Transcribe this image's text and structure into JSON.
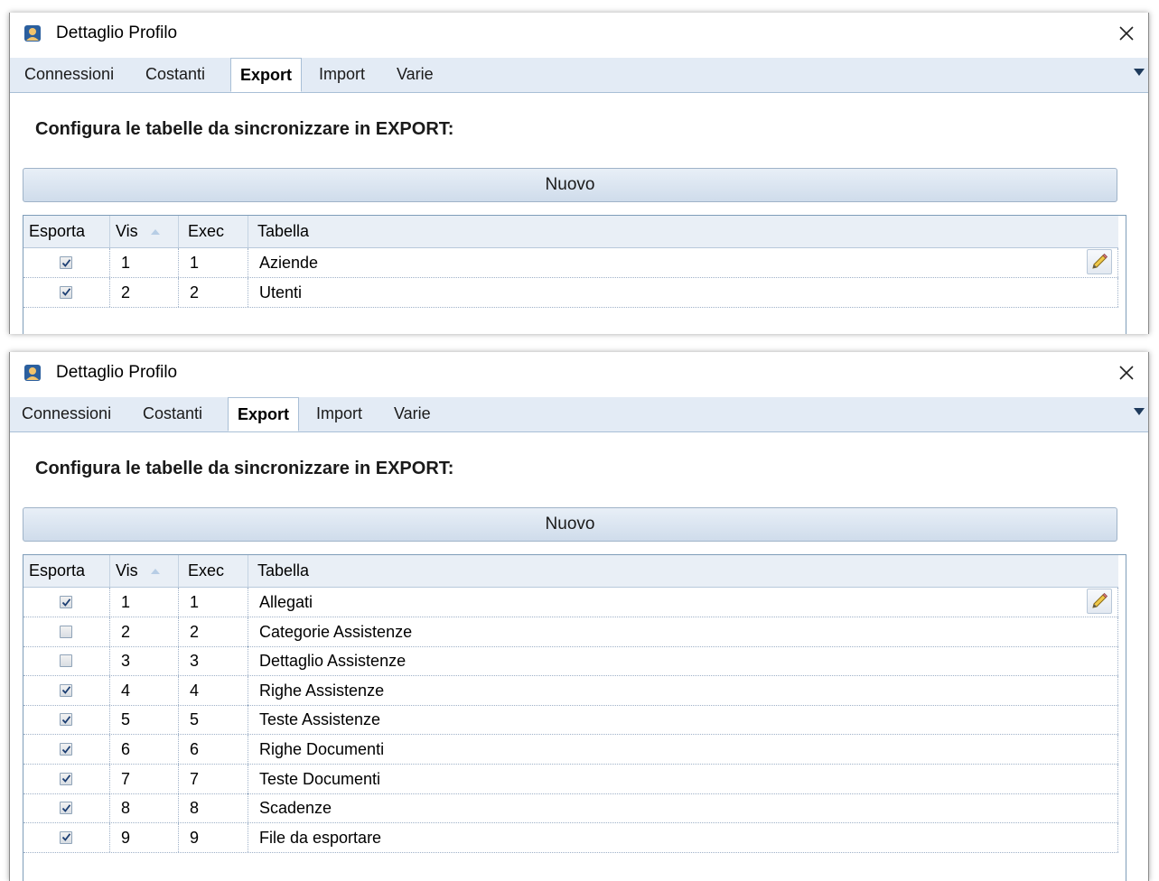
{
  "windows": [
    {
      "title": "Dettaglio Profilo",
      "tabs": [
        "Connessioni",
        "Costanti",
        "Export",
        "Import",
        "Varie"
      ],
      "active_tab": "Export",
      "heading": "Configura le tabelle da sincronizzare in EXPORT:",
      "new_button": "Nuovo",
      "columns": [
        "Esporta",
        "Vis",
        "Exec",
        "Tabella"
      ],
      "rows": [
        {
          "esporta": true,
          "vis": "1",
          "exec": "1",
          "tabella": "Aziende"
        },
        {
          "esporta": true,
          "vis": "2",
          "exec": "2",
          "tabella": "Utenti"
        }
      ]
    },
    {
      "title": "Dettaglio Profilo",
      "tabs": [
        "Connessioni",
        "Costanti",
        "Export",
        "Import",
        "Varie"
      ],
      "active_tab": "Export",
      "heading": "Configura le tabelle da sincronizzare in EXPORT:",
      "new_button": "Nuovo",
      "columns": [
        "Esporta",
        "Vis",
        "Exec",
        "Tabella"
      ],
      "rows": [
        {
          "esporta": true,
          "vis": "1",
          "exec": "1",
          "tabella": "Allegati"
        },
        {
          "esporta": false,
          "vis": "2",
          "exec": "2",
          "tabella": "Categorie Assistenze"
        },
        {
          "esporta": false,
          "vis": "3",
          "exec": "3",
          "tabella": "Dettaglio Assistenze"
        },
        {
          "esporta": true,
          "vis": "4",
          "exec": "4",
          "tabella": "Righe Assistenze"
        },
        {
          "esporta": true,
          "vis": "5",
          "exec": "5",
          "tabella": "Teste Assistenze"
        },
        {
          "esporta": true,
          "vis": "6",
          "exec": "6",
          "tabella": "Righe Documenti"
        },
        {
          "esporta": true,
          "vis": "7",
          "exec": "7",
          "tabella": "Teste Documenti"
        },
        {
          "esporta": true,
          "vis": "8",
          "exec": "8",
          "tabella": "Scadenze"
        },
        {
          "esporta": true,
          "vis": "9",
          "exec": "9",
          "tabella": "File da esportare"
        }
      ]
    }
  ],
  "icons": {
    "app": "profile-app-icon",
    "close": "close-icon",
    "tab_overflow": "chevron-down-icon",
    "sort": "sort-ascending-icon",
    "edit": "pencil-icon",
    "checkbox": "checkbox-icon"
  },
  "colors": {
    "tab_strip": "#e3ebf5",
    "button_top": "#e8eff7",
    "button_bottom": "#cfdceb",
    "grid_header": "#e9eff6",
    "grid_border": "#7f9db9"
  }
}
